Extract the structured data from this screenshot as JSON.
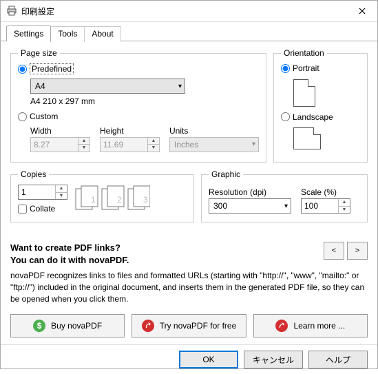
{
  "window": {
    "title": "印刷設定"
  },
  "tabs": {
    "settings": "Settings",
    "tools": "Tools",
    "about": "About"
  },
  "pagesize": {
    "legend": "Page size",
    "predefined_label": "Predefined",
    "predefined_value": "A4",
    "predefined_sub": "A4 210 x 297 mm",
    "custom_label": "Custom",
    "width_label": "Width",
    "width_value": "8.27",
    "height_label": "Height",
    "height_value": "11.69",
    "units_label": "Units",
    "units_value": "Inches"
  },
  "orientation": {
    "legend": "Orientation",
    "portrait_label": "Portrait",
    "landscape_label": "Landscape"
  },
  "copies": {
    "legend": "Copies",
    "value": "1",
    "collate_label": "Collate"
  },
  "graphic": {
    "legend": "Graphic",
    "resolution_label": "Resolution (dpi)",
    "resolution_value": "300",
    "scale_label": "Scale (%)",
    "scale_value": "100"
  },
  "tip": {
    "title_line1": "Want to create PDF links?",
    "title_line2": "You can do it with novaPDF.",
    "body": "novaPDF recognizes links to files and formatted URLs (starting with \"http://\", \"www\", \"mailto:\" or \"ftp://\") included in the original document, and inserts them in the generated PDF file, so they can be opened when you click them.",
    "prev": "<",
    "next": ">"
  },
  "actions": {
    "buy": "Buy novaPDF",
    "try": "Try novaPDF for free",
    "learn": "Learn more ..."
  },
  "footer": {
    "ok": "OK",
    "cancel": "キャンセル",
    "help": "ヘルプ"
  }
}
